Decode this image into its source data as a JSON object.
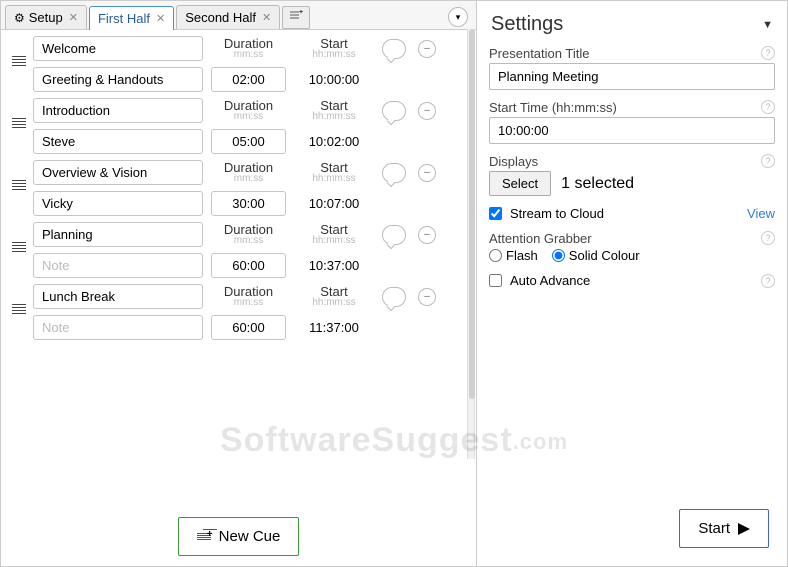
{
  "tabs": {
    "setup": "Setup",
    "first_half": "First Half",
    "second_half": "Second Half"
  },
  "headers": {
    "duration_label": "Duration",
    "duration_sub": "mm:ss",
    "start_label": "Start",
    "start_sub": "hh:mm:ss"
  },
  "cues": [
    {
      "title": "Welcome",
      "subtitle": "Greeting & Handouts",
      "sub_placeholder": false,
      "duration": "02:00",
      "start": "10:00:00"
    },
    {
      "title": "Introduction",
      "subtitle": "Steve",
      "sub_placeholder": false,
      "duration": "05:00",
      "start": "10:02:00"
    },
    {
      "title": "Overview & Vision",
      "subtitle": "Vicky",
      "sub_placeholder": false,
      "duration": "30:00",
      "start": "10:07:00"
    },
    {
      "title": "Planning",
      "subtitle": "Note",
      "sub_placeholder": true,
      "duration": "60:00",
      "start": "10:37:00"
    },
    {
      "title": "Lunch Break",
      "subtitle": "Note",
      "sub_placeholder": true,
      "duration": "60:00",
      "start": "11:37:00"
    }
  ],
  "buttons": {
    "new_cue": "New Cue",
    "start": "Start"
  },
  "settings": {
    "heading": "Settings",
    "title_label": "Presentation Title",
    "title_value": "Planning Meeting",
    "start_label": "Start Time (hh:mm:ss)",
    "start_value": "10:00:00",
    "displays_label": "Displays",
    "select_button": "Select",
    "displays_count": "1 selected",
    "stream_label": "Stream to Cloud",
    "view_link": "View",
    "attention_label": "Attention Grabber",
    "flash_label": "Flash",
    "solid_label": "Solid Colour",
    "auto_advance_label": "Auto Advance"
  },
  "watermark": {
    "main": "SoftwareSuggest",
    "dom": ".com"
  }
}
